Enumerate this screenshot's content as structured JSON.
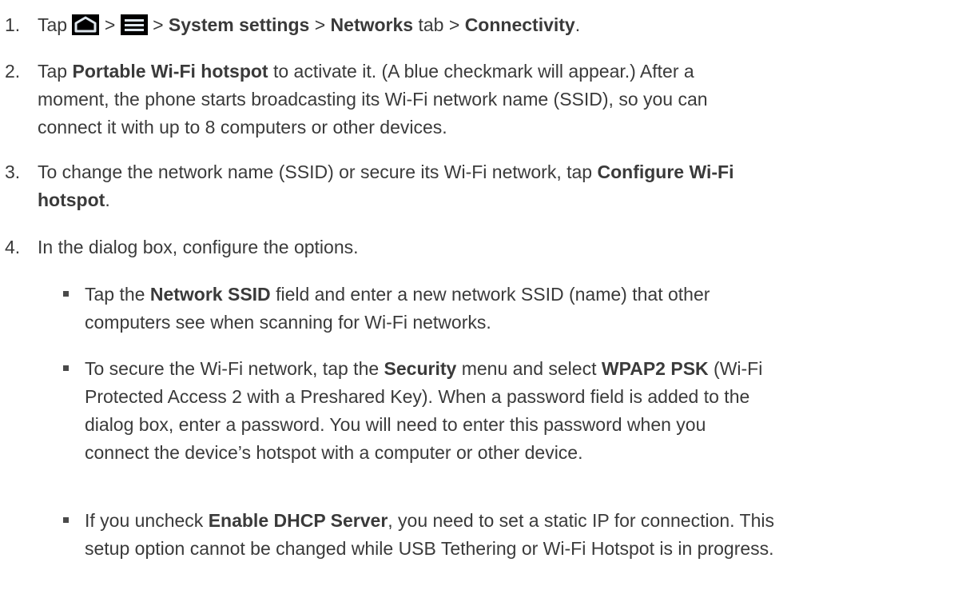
{
  "steps": [
    {
      "num": "1.",
      "prefix": "Tap",
      "sep1": ">",
      "sep2": ">",
      "sep3": ">",
      "sep4": ">",
      "system_settings": "System settings",
      "networks": "Networks",
      "tab": "tab",
      "connectivity": "Connectivity",
      "end": ".",
      "icon_home": "home-icon",
      "icon_menu": "menu-icon"
    },
    {
      "num": "2.",
      "line1_a": "Tap",
      "line1_b": "Portable Wi-Fi hotspot",
      "line1_c": "to activate it. (A blue checkmark will appear.) After a",
      "line2": "moment, the phone starts broadcasting its Wi-Fi network name (SSID), so you can",
      "line3": "connect it with up to 8 computers or other devices."
    },
    {
      "num": "3.",
      "line1_a": "To change the network name (SSID) or secure its Wi-Fi network, tap",
      "line1_b": "Configure Wi-Fi",
      "line2_b": "hotspot",
      "line2_end": "."
    },
    {
      "num": "4.",
      "text": "In the dialog box, configure the options."
    }
  ],
  "bullets": [
    {
      "line1_a": "Tap the",
      "line1_b": "Network SSID",
      "line1_c": "field and enter a new network SSID (name) that other",
      "line2": "computers see when scanning for Wi-Fi networks."
    },
    {
      "line1_a": "To secure the Wi-Fi network, tap the",
      "line1_b": "Security",
      "line1_c": "menu and select",
      "line1_d": "WPAP2 PSK",
      "line1_e": "(Wi-Fi",
      "line2": "Protected Access 2 with a Preshared Key). When a password field is added to the",
      "line3": "dialog box, enter a password. You will need to enter this password when you",
      "line4": "connect the device’s hotspot with a computer or other device."
    },
    {
      "line1_a": "If you uncheck",
      "line1_b": "Enable DHCP Server",
      "line1_c": ", you need to set a static IP for connection. This",
      "line2": "setup option cannot be changed while USB Tethering or Wi-Fi Hotspot is in progress."
    }
  ]
}
